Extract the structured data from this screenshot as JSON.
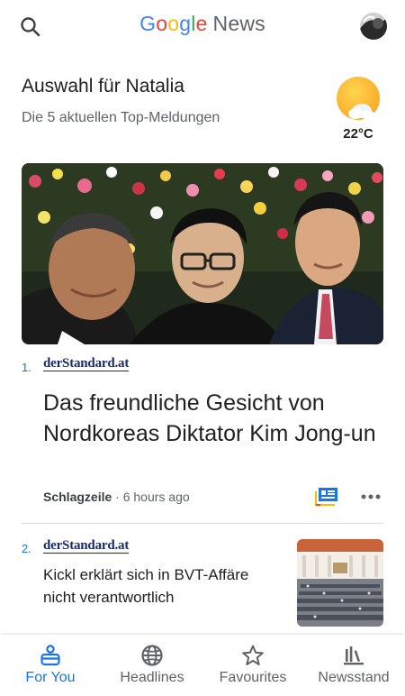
{
  "app": {
    "logo_word": [
      "G",
      "o",
      "o",
      "g",
      "l",
      "e"
    ],
    "logo_suffix": "News"
  },
  "briefing": {
    "title": "Auswahl für Natalia",
    "subtitle": "Die 5 aktuellen Top-Meldungen"
  },
  "weather": {
    "temperature": "22°C",
    "icon": "partly-sunny-icon"
  },
  "stories": [
    {
      "number": "1.",
      "source": "derStandard.at",
      "headline": "Das freundliche Gesicht von Nordkoreas Diktator Kim Jong-un",
      "category": "Schlagzeile",
      "separator": "·",
      "time": "6 hours ago"
    },
    {
      "number": "2.",
      "source": "derStandard.at",
      "headline": "Kickl erklärt sich in BVT-Affäre nicht verantwortlich"
    }
  ],
  "bottom_nav": [
    {
      "label": "For You",
      "icon": "for-you-icon",
      "active": true
    },
    {
      "label": "Headlines",
      "icon": "globe-icon",
      "active": false
    },
    {
      "label": "Favourites",
      "icon": "star-icon",
      "active": false
    },
    {
      "label": "Newsstand",
      "icon": "newsstand-icon",
      "active": false
    }
  ],
  "colors": {
    "accent": "#1a73e8",
    "google_blue": "#4285f4",
    "google_red": "#ea4335",
    "google_yellow": "#fbbc05",
    "google_green": "#34a853",
    "source_navy": "#1a2b6d",
    "sun": "#fbbc05"
  }
}
